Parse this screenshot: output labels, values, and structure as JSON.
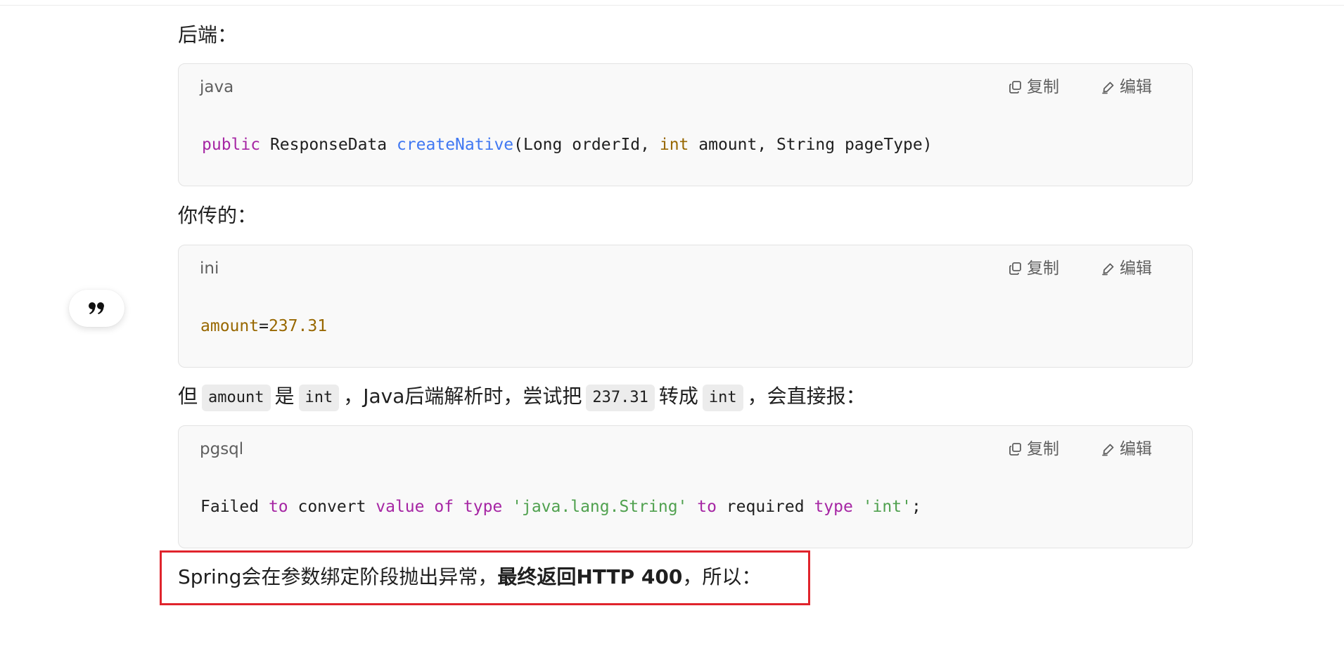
{
  "sections": {
    "backend_label": "后端：",
    "passed_label": "你传的：",
    "conclusion": {
      "prefix": "Spring会在参数绑定阶段抛出异常，",
      "bold": "最终返回HTTP 400",
      "suffix": "，所以："
    }
  },
  "code_actions": {
    "copy_label": "复制",
    "edit_label": "编辑"
  },
  "code_blocks": [
    {
      "lang": "java",
      "tokens": [
        "public",
        " ResponseData ",
        "createNative",
        "(Long orderId, ",
        "int",
        " amount, String pageType)"
      ]
    },
    {
      "lang": "ini",
      "tokens": [
        "amount",
        "=",
        "237.31"
      ]
    },
    {
      "lang": "pgsql",
      "tokens": [
        "Failed ",
        "to",
        " convert ",
        "value of type",
        " ",
        "'java.lang.String'",
        " ",
        "to",
        " required ",
        "type",
        " ",
        "'int'",
        ";"
      ]
    }
  ],
  "explanation": {
    "t1": "但",
    "c1": "amount",
    "t2": "是",
    "c2": "int",
    "t3": "，Java后端解析时，尝试把",
    "c3": "237.31",
    "t4": "转成",
    "c4": "int",
    "t5": "，会直接报："
  },
  "icons": {
    "quote": "quote-icon",
    "copy": "copy-icon",
    "edit": "edit-icon"
  },
  "colors": {
    "keyword": "#a626a4",
    "function": "#4078f2",
    "type": "#986801",
    "string": "#50a14f",
    "highlight_border": "#e0242c"
  }
}
